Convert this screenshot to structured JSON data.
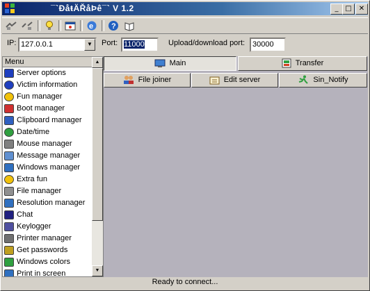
{
  "window": {
    "title": "¯`·.¸¸.ÐåŧÄŘåÞê¸¸.·´¯ V 1.2",
    "title_short": "¯`ÐåŧÄŘåÞê¯` V 1.2"
  },
  "titlebar_buttons": {
    "minimize": "_",
    "maximize": "□",
    "close": "✕"
  },
  "toolbar_icons": [
    "connect-icon",
    "disconnect-icon",
    "lightbulb-icon",
    "screenshot-icon",
    "browser-icon",
    "help-icon",
    "about-icon"
  ],
  "connection": {
    "ip_label": "IP:",
    "ip_value": "127.0.0.1",
    "port_label": "Port:",
    "port_value": "11000",
    "updown_label": "Upload/download port:",
    "updown_value": "30000"
  },
  "menu": {
    "header": "Menu",
    "items": [
      {
        "label": "Server options",
        "icon": "server-options-icon",
        "color": "#1f3fbf"
      },
      {
        "label": "Victim information",
        "icon": "info-icon",
        "color": "#1f3fbf"
      },
      {
        "label": "Fun manager",
        "icon": "smiley-icon",
        "color": "#f2c20a"
      },
      {
        "label": "Boot manager",
        "icon": "boot-icon",
        "color": "#d03030"
      },
      {
        "label": "Clipboard manager",
        "icon": "clipboard-icon",
        "color": "#3060c0"
      },
      {
        "label": "Date/time",
        "icon": "clock-icon",
        "color": "#30a040"
      },
      {
        "label": "Mouse manager",
        "icon": "mouse-icon",
        "color": "#808080"
      },
      {
        "label": "Message manager",
        "icon": "message-icon",
        "color": "#6090d0"
      },
      {
        "label": "Windows manager",
        "icon": "windows-icon",
        "color": "#3070c0"
      },
      {
        "label": "Extra fun",
        "icon": "smiley-icon",
        "color": "#f2c20a"
      },
      {
        "label": "File manager",
        "icon": "file-icon",
        "color": "#909090"
      },
      {
        "label": "Resolution manager",
        "icon": "monitor-icon",
        "color": "#3070c0"
      },
      {
        "label": "Chat",
        "icon": "chat-icon",
        "color": "#202080"
      },
      {
        "label": "Keylogger",
        "icon": "keylogger-icon",
        "color": "#5050a0"
      },
      {
        "label": "Printer manager",
        "icon": "printer-icon",
        "color": "#707070"
      },
      {
        "label": "Get passwords",
        "icon": "key-icon",
        "color": "#c0a020"
      },
      {
        "label": "Windows colors",
        "icon": "colors-icon",
        "color": "#30a040"
      },
      {
        "label": "Print in screen",
        "icon": "print-screen-icon",
        "color": "#3070c0"
      }
    ]
  },
  "tabs": [
    {
      "label": "Main",
      "icon": "main-tab-icon"
    },
    {
      "label": "Transfer",
      "icon": "transfer-tab-icon"
    }
  ],
  "actions": [
    {
      "label": "File joiner",
      "icon": "users-icon"
    },
    {
      "label": "Edit server",
      "icon": "edit-server-icon"
    },
    {
      "label": "Sin_Notify",
      "icon": "runner-icon"
    }
  ],
  "status": {
    "text": "Ready to connect..."
  }
}
